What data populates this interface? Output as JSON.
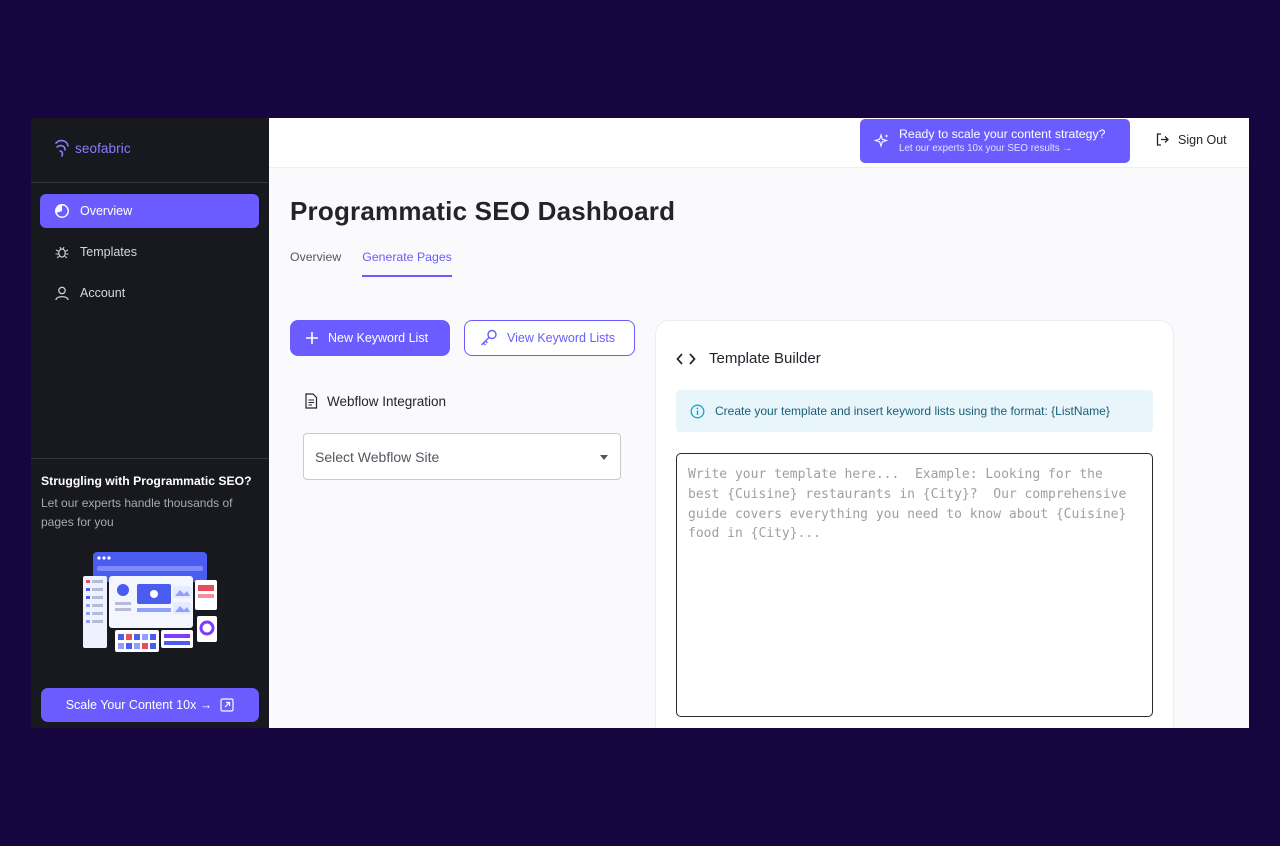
{
  "brand": {
    "name": "seofabric",
    "color": "#6a5cff"
  },
  "sidebar": {
    "items": [
      {
        "label": "Overview",
        "icon": "pie-chart-icon",
        "active": true
      },
      {
        "label": "Templates",
        "icon": "bug-icon",
        "active": false
      },
      {
        "label": "Account",
        "icon": "user-icon",
        "active": false
      }
    ],
    "promo": {
      "title": "Struggling with Programmatic SEO?",
      "description": "Let our experts handle thousands of pages for you",
      "button_label": "Scale Your Content 10x →"
    }
  },
  "header": {
    "cta_title": "Ready to scale your content strategy?",
    "cta_subtitle": "Let our experts 10x your SEO results →",
    "sign_out_label": "Sign Out"
  },
  "main": {
    "title": "Programmatic SEO Dashboard",
    "tabs": [
      {
        "label": "Overview",
        "active": false
      },
      {
        "label": "Generate Pages",
        "active": true
      }
    ],
    "new_keyword_list_label": "New Keyword List",
    "view_keyword_lists_label": "View Keyword Lists",
    "webflow": {
      "heading": "Webflow Integration",
      "select_placeholder": "Select Webflow Site"
    },
    "template_builder": {
      "heading": "Template Builder",
      "info_text": "Create your template and insert keyword lists using the format: {ListName}",
      "editor_placeholder": "Write your template here...  Example: Looking for the best {Cuisine} restaurants in {City}?  Our comprehensive guide covers everything you need to know about {Cuisine} food in {City}..."
    }
  }
}
